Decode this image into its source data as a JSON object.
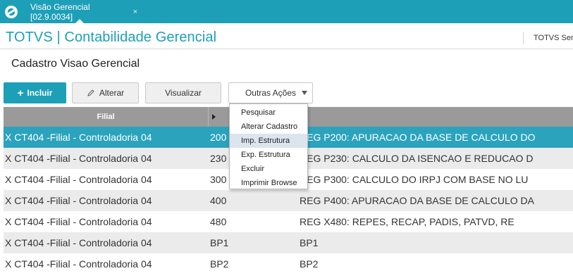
{
  "tabbar": {
    "logo_icon": "totvs-logo-icon",
    "tab_label": "Visão Gerencial [02.9.0034]",
    "tab_close": "×",
    "bg_color": "#1d9fb8"
  },
  "header": {
    "title": "TOTVS | Contabilidade Gerencial",
    "system_label": "TOTVS Ser"
  },
  "page": {
    "title": "Cadastro Visao Gerencial"
  },
  "toolbar": {
    "incluir_label": "Incluir",
    "alterar_label": "Alterar",
    "visualizar_label": "Visualizar",
    "outras_label": "Outras Ações"
  },
  "grid": {
    "columns": [
      "Filial"
    ],
    "rows": [
      {
        "filial": "X CT404 -Filial - Controladoria 04",
        "code": "200",
        "desc": "REG P200: APURACAO DA BASE DE CALCULO DO",
        "selected": true
      },
      {
        "filial": "X CT404 -Filial - Controladoria 04",
        "code": "230",
        "desc": "REG P230: CALCULO DA ISENCAO E REDUCAO D"
      },
      {
        "filial": "X CT404 -Filial - Controladoria 04",
        "code": "300",
        "desc": "REG P300: CALCULO DO IRPJ COM BASE NO LU"
      },
      {
        "filial": "X CT404 -Filial - Controladoria 04",
        "code": "400",
        "desc": "REG P400: APURACAO DA BASE DE CALCULO DA"
      },
      {
        "filial": "X CT404 -Filial - Controladoria 04",
        "code": "480",
        "desc": "REG X480: REPES, RECAP, PADIS, PATVD, RE"
      },
      {
        "filial": "X CT404 -Filial - Controladoria 04",
        "code": "BP1",
        "desc": "BP1"
      },
      {
        "filial": "X CT404 -Filial - Controladoria 04",
        "code": "BP2",
        "desc": "BP2"
      }
    ]
  },
  "menu": {
    "items": [
      "Pesquisar",
      "Alterar Cadastro",
      "Imp. Estrutura",
      "Exp. Estrutura",
      "Excluir",
      "Imprimir Browse"
    ],
    "hovered_index": 2
  }
}
